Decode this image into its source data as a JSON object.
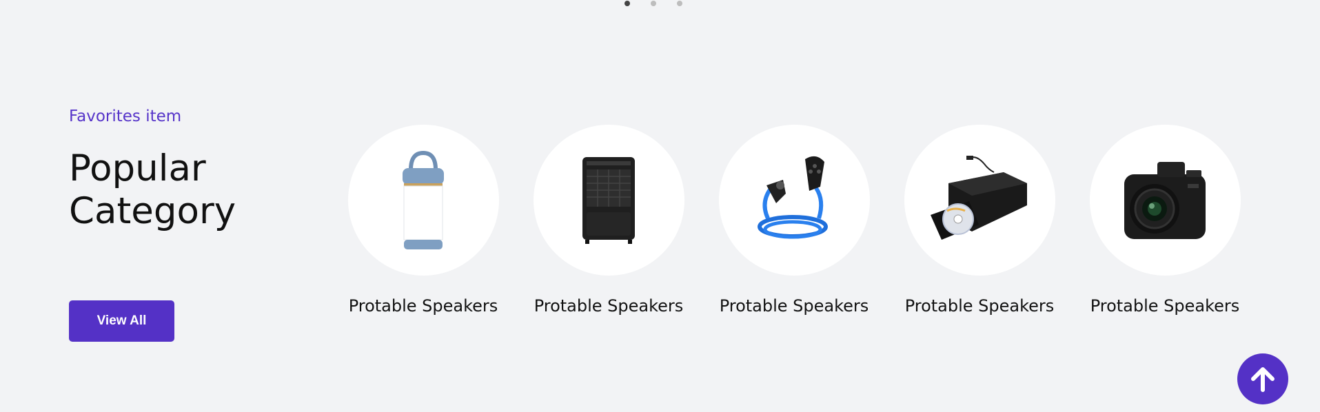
{
  "carousel": {
    "dots": 3,
    "active_index": 0
  },
  "section": {
    "eyebrow": "Favorites item",
    "title_line1": "Popular",
    "title_line2": "Category",
    "view_all_label": "View All"
  },
  "categories": [
    {
      "label": "Protable Speakers",
      "icon": "portable-speaker-icon"
    },
    {
      "label": "Protable Speakers",
      "icon": "dehumidifier-icon"
    },
    {
      "label": "Protable Speakers",
      "icon": "ev-charger-cable-icon"
    },
    {
      "label": "Protable Speakers",
      "icon": "external-dvd-drive-icon"
    },
    {
      "label": "Protable Speakers",
      "icon": "camera-icon"
    }
  ],
  "back_to_top": {
    "icon": "arrow-up-icon"
  },
  "colors": {
    "accent": "#5431c6",
    "eyebrow": "#5634c9",
    "background": "#f2f3f5"
  }
}
